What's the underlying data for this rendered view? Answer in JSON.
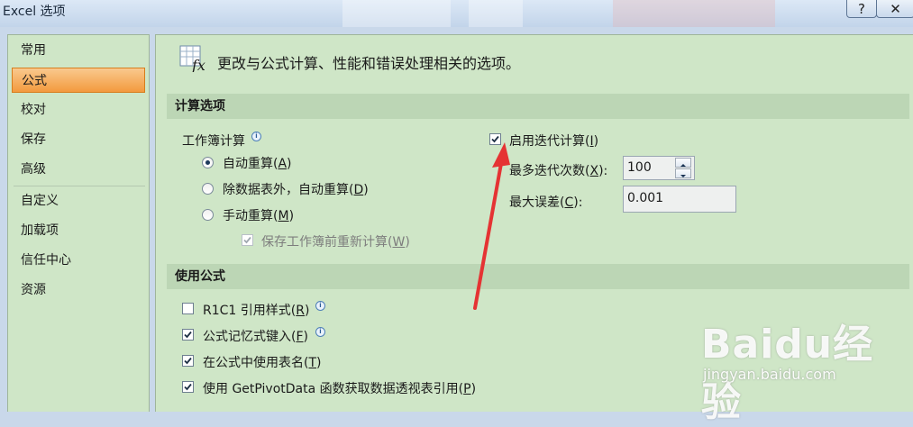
{
  "window": {
    "title": "Excel 选项",
    "help": "?",
    "close": "✕"
  },
  "sidebar": {
    "items": [
      {
        "label": "常用"
      },
      {
        "label": "公式",
        "active": true
      },
      {
        "label": "校对"
      },
      {
        "label": "保存"
      },
      {
        "label": "高级"
      },
      {
        "label": "自定义"
      },
      {
        "label": "加载项"
      },
      {
        "label": "信任中心"
      },
      {
        "label": "资源"
      }
    ]
  },
  "header": {
    "icon": "function-icon",
    "text": "更改与公式计算、性能和错误处理相关的选项。"
  },
  "calc": {
    "section_title": "计算选项",
    "workbook_label": "工作簿计算",
    "radio_auto": {
      "label": "自动重算",
      "key": "A",
      "checked": true
    },
    "radio_auto_except": {
      "label": "除数据表外，自动重算",
      "key": "D",
      "checked": false
    },
    "radio_manual": {
      "label": "手动重算",
      "key": "M",
      "checked": false
    },
    "recalc_before_save": {
      "label": "保存工作簿前重新计算",
      "key": "W",
      "checked": true,
      "disabled": true
    },
    "iterative": {
      "label": "启用迭代计算",
      "key": "I",
      "checked": true
    },
    "max_iterations": {
      "label": "最多迭代次数",
      "key": "X",
      "value": "100"
    },
    "max_change": {
      "label": "最大误差",
      "key": "C",
      "value": "0.001"
    }
  },
  "formulas": {
    "section_title": "使用公式",
    "r1c1": {
      "label": "R1C1 引用样式",
      "key": "R",
      "checked": false
    },
    "autocomplete": {
      "label": "公式记忆式键入",
      "key": "F",
      "checked": true
    },
    "table_names": {
      "label": "在公式中使用表名",
      "key": "T",
      "checked": true
    },
    "getpivot": {
      "label": "使用 GetPivotData 函数获取数据透视表引用",
      "key": "P",
      "checked": true
    }
  },
  "watermark": {
    "logo": "Baidu经验",
    "url": "jingyan.baidu.com"
  },
  "colors": {
    "active_nav": "#f39a3e",
    "panel_bg": "#cfe6c7",
    "section_bar": "#bcd6b5",
    "arrow": "#e53333"
  }
}
